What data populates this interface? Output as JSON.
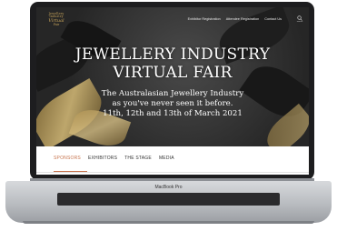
{
  "device": {
    "model_label": "MacBook Pro"
  },
  "logo": {
    "line1": "Jewellery Industry",
    "line2": "Virtual",
    "line3": "Fair"
  },
  "nav": {
    "items": [
      "Exhibitor Registration",
      "Attendee Registration",
      "Contact Us"
    ]
  },
  "search": {
    "label": "search"
  },
  "hero": {
    "title_line1": "JEWELLERY INDUSTRY",
    "title_line2": "VIRTUAL FAIR",
    "subtitle_line1": "The Australasian Jewellery Industry",
    "subtitle_line2": "as you've never seen it before.",
    "dates": "11th, 12th and 13th of March 2021"
  },
  "tabs": {
    "items": [
      "SPONSORS",
      "EXHIBITORS",
      "THE STAGE",
      "MEDIA"
    ],
    "active_index": 0
  },
  "colors": {
    "gold": "#c9a55b",
    "accent": "#c7744e",
    "hero_bg": "#2e2e2e"
  }
}
